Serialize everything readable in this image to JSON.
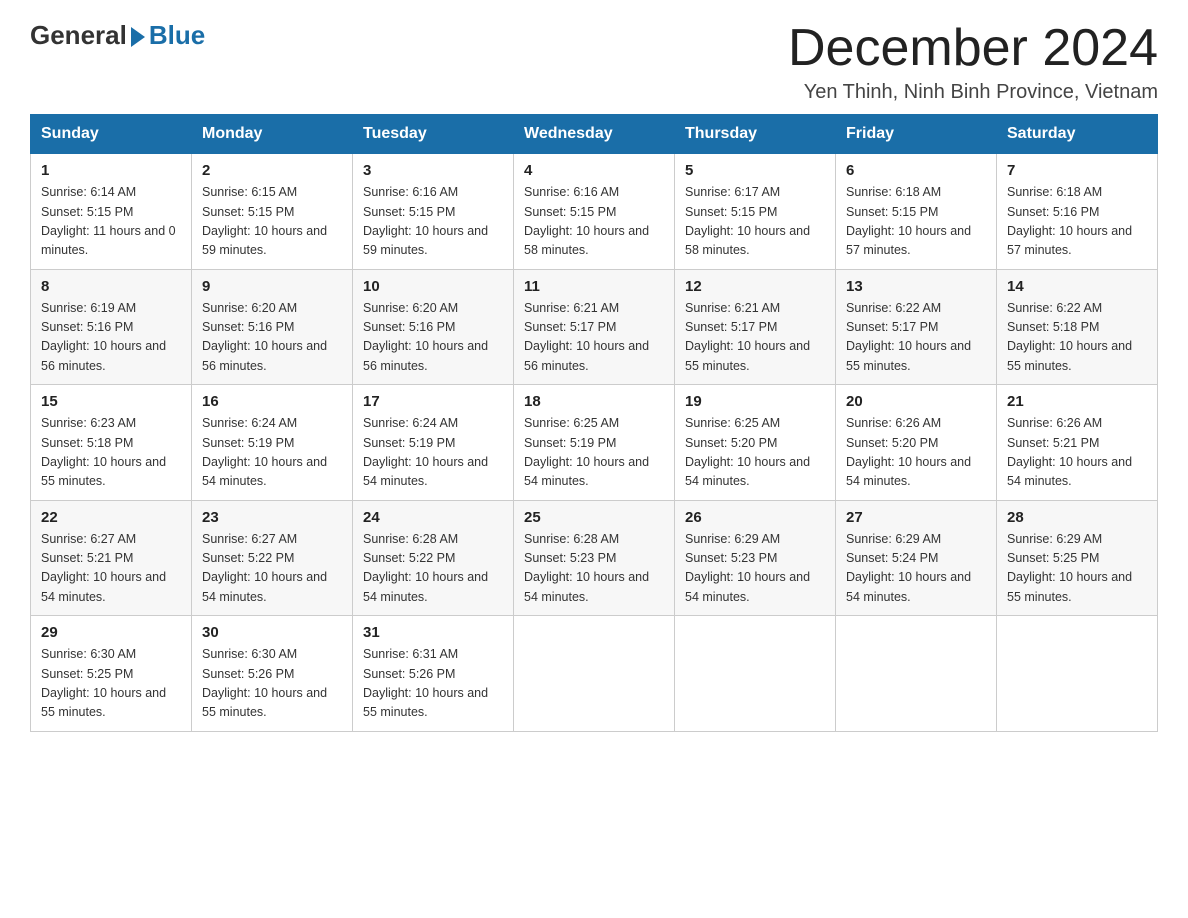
{
  "header": {
    "logo_general": "General",
    "logo_blue": "Blue",
    "month_title": "December 2024",
    "location": "Yen Thinh, Ninh Binh Province, Vietnam"
  },
  "days_of_week": [
    "Sunday",
    "Monday",
    "Tuesday",
    "Wednesday",
    "Thursday",
    "Friday",
    "Saturday"
  ],
  "weeks": [
    [
      {
        "day": "1",
        "sunrise": "6:14 AM",
        "sunset": "5:15 PM",
        "daylight": "11 hours and 0 minutes."
      },
      {
        "day": "2",
        "sunrise": "6:15 AM",
        "sunset": "5:15 PM",
        "daylight": "10 hours and 59 minutes."
      },
      {
        "day": "3",
        "sunrise": "6:16 AM",
        "sunset": "5:15 PM",
        "daylight": "10 hours and 59 minutes."
      },
      {
        "day": "4",
        "sunrise": "6:16 AM",
        "sunset": "5:15 PM",
        "daylight": "10 hours and 58 minutes."
      },
      {
        "day": "5",
        "sunrise": "6:17 AM",
        "sunset": "5:15 PM",
        "daylight": "10 hours and 58 minutes."
      },
      {
        "day": "6",
        "sunrise": "6:18 AM",
        "sunset": "5:15 PM",
        "daylight": "10 hours and 57 minutes."
      },
      {
        "day": "7",
        "sunrise": "6:18 AM",
        "sunset": "5:16 PM",
        "daylight": "10 hours and 57 minutes."
      }
    ],
    [
      {
        "day": "8",
        "sunrise": "6:19 AM",
        "sunset": "5:16 PM",
        "daylight": "10 hours and 56 minutes."
      },
      {
        "day": "9",
        "sunrise": "6:20 AM",
        "sunset": "5:16 PM",
        "daylight": "10 hours and 56 minutes."
      },
      {
        "day": "10",
        "sunrise": "6:20 AM",
        "sunset": "5:16 PM",
        "daylight": "10 hours and 56 minutes."
      },
      {
        "day": "11",
        "sunrise": "6:21 AM",
        "sunset": "5:17 PM",
        "daylight": "10 hours and 56 minutes."
      },
      {
        "day": "12",
        "sunrise": "6:21 AM",
        "sunset": "5:17 PM",
        "daylight": "10 hours and 55 minutes."
      },
      {
        "day": "13",
        "sunrise": "6:22 AM",
        "sunset": "5:17 PM",
        "daylight": "10 hours and 55 minutes."
      },
      {
        "day": "14",
        "sunrise": "6:22 AM",
        "sunset": "5:18 PM",
        "daylight": "10 hours and 55 minutes."
      }
    ],
    [
      {
        "day": "15",
        "sunrise": "6:23 AM",
        "sunset": "5:18 PM",
        "daylight": "10 hours and 55 minutes."
      },
      {
        "day": "16",
        "sunrise": "6:24 AM",
        "sunset": "5:19 PM",
        "daylight": "10 hours and 54 minutes."
      },
      {
        "day": "17",
        "sunrise": "6:24 AM",
        "sunset": "5:19 PM",
        "daylight": "10 hours and 54 minutes."
      },
      {
        "day": "18",
        "sunrise": "6:25 AM",
        "sunset": "5:19 PM",
        "daylight": "10 hours and 54 minutes."
      },
      {
        "day": "19",
        "sunrise": "6:25 AM",
        "sunset": "5:20 PM",
        "daylight": "10 hours and 54 minutes."
      },
      {
        "day": "20",
        "sunrise": "6:26 AM",
        "sunset": "5:20 PM",
        "daylight": "10 hours and 54 minutes."
      },
      {
        "day": "21",
        "sunrise": "6:26 AM",
        "sunset": "5:21 PM",
        "daylight": "10 hours and 54 minutes."
      }
    ],
    [
      {
        "day": "22",
        "sunrise": "6:27 AM",
        "sunset": "5:21 PM",
        "daylight": "10 hours and 54 minutes."
      },
      {
        "day": "23",
        "sunrise": "6:27 AM",
        "sunset": "5:22 PM",
        "daylight": "10 hours and 54 minutes."
      },
      {
        "day": "24",
        "sunrise": "6:28 AM",
        "sunset": "5:22 PM",
        "daylight": "10 hours and 54 minutes."
      },
      {
        "day": "25",
        "sunrise": "6:28 AM",
        "sunset": "5:23 PM",
        "daylight": "10 hours and 54 minutes."
      },
      {
        "day": "26",
        "sunrise": "6:29 AM",
        "sunset": "5:23 PM",
        "daylight": "10 hours and 54 minutes."
      },
      {
        "day": "27",
        "sunrise": "6:29 AM",
        "sunset": "5:24 PM",
        "daylight": "10 hours and 54 minutes."
      },
      {
        "day": "28",
        "sunrise": "6:29 AM",
        "sunset": "5:25 PM",
        "daylight": "10 hours and 55 minutes."
      }
    ],
    [
      {
        "day": "29",
        "sunrise": "6:30 AM",
        "sunset": "5:25 PM",
        "daylight": "10 hours and 55 minutes."
      },
      {
        "day": "30",
        "sunrise": "6:30 AM",
        "sunset": "5:26 PM",
        "daylight": "10 hours and 55 minutes."
      },
      {
        "day": "31",
        "sunrise": "6:31 AM",
        "sunset": "5:26 PM",
        "daylight": "10 hours and 55 minutes."
      },
      null,
      null,
      null,
      null
    ]
  ]
}
